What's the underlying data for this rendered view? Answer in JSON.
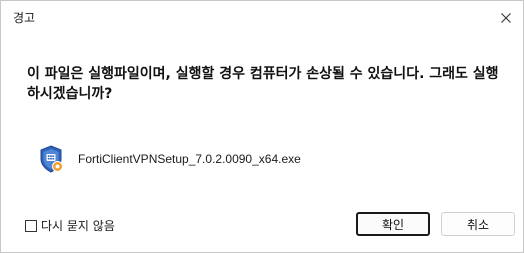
{
  "window": {
    "title": "경고",
    "close_icon": "close-icon"
  },
  "message": {
    "text": "이 파일은 실행파일이며, 실행할 경우 컴퓨터가 손상될 수 있습니다. 그래도 실행하시겠습니까?"
  },
  "file": {
    "icon": "forticlient-shield-icon",
    "name": "FortiClientVPNSetup_7.0.2.0090_x64.exe"
  },
  "footer": {
    "checkbox_label": "다시 묻지 않음",
    "checkbox_checked": false,
    "ok_label": "확인",
    "cancel_label": "취소"
  },
  "colors": {
    "shield_blue": "#2f63b8",
    "badge_orange": "#f0a030"
  }
}
